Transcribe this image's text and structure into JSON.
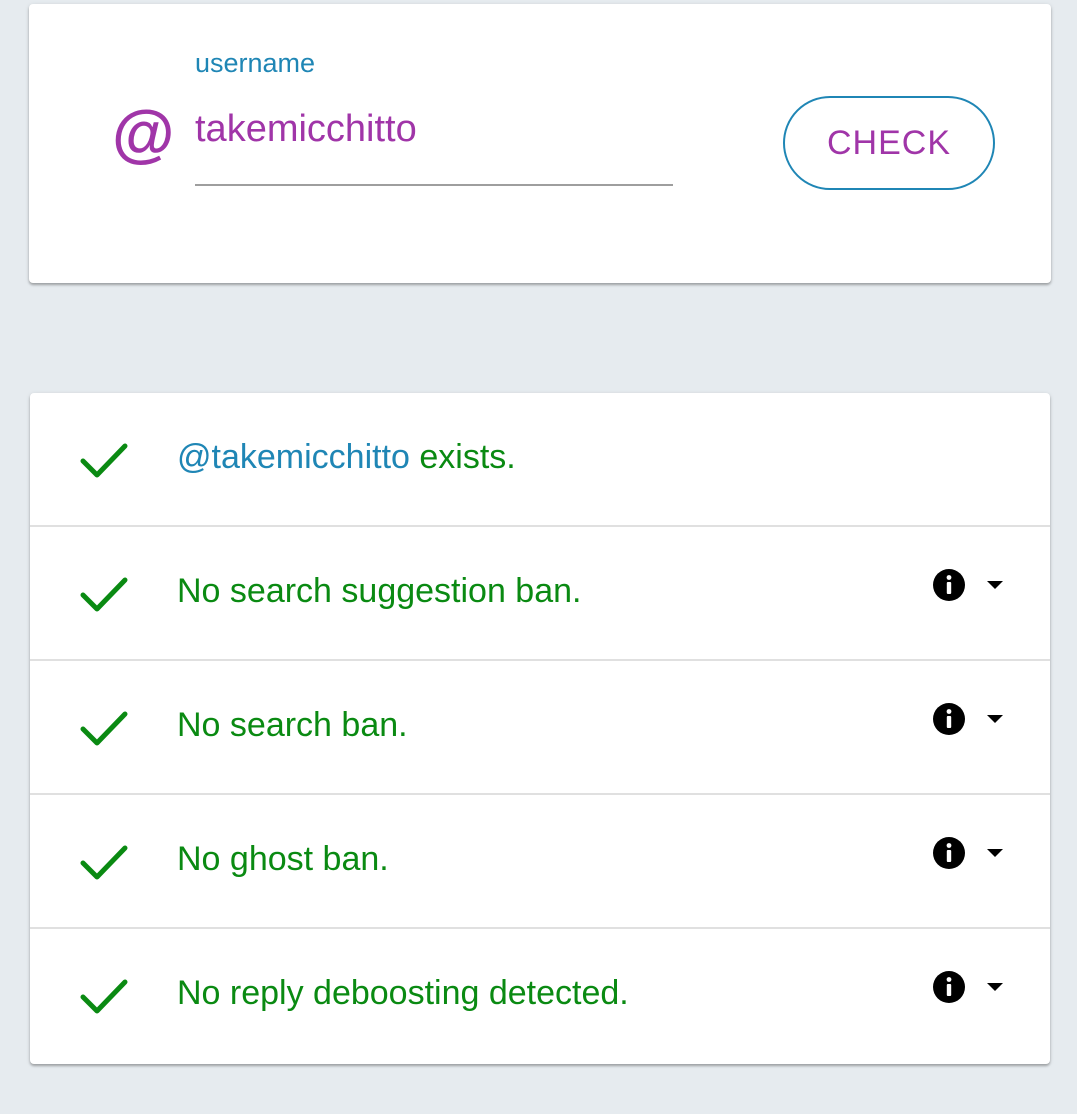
{
  "form": {
    "field_label": "username",
    "username_value": "takemicchitto",
    "at_symbol": "@",
    "check_label": "CHECK"
  },
  "results": [
    {
      "mention": "@takemicchitto",
      "text": " exists.",
      "status": "ok",
      "has_details": false
    },
    {
      "mention": "",
      "text": "No search suggestion ban.",
      "status": "ok",
      "has_details": true
    },
    {
      "mention": "",
      "text": "No search ban.",
      "status": "ok",
      "has_details": true
    },
    {
      "mention": "",
      "text": "No ghost ban.",
      "status": "ok",
      "has_details": true
    },
    {
      "mention": "",
      "text": "No reply deboosting detected.",
      "status": "ok",
      "has_details": true
    }
  ],
  "icons": {
    "status_icon": "check-icon",
    "info_icon": "info-icon",
    "expand_icon": "caret-down-icon"
  },
  "colors": {
    "accent_purple": "#a035a8",
    "accent_blue": "#1f86b5",
    "success_green": "#0a8a12",
    "background": "#e6ebef"
  }
}
